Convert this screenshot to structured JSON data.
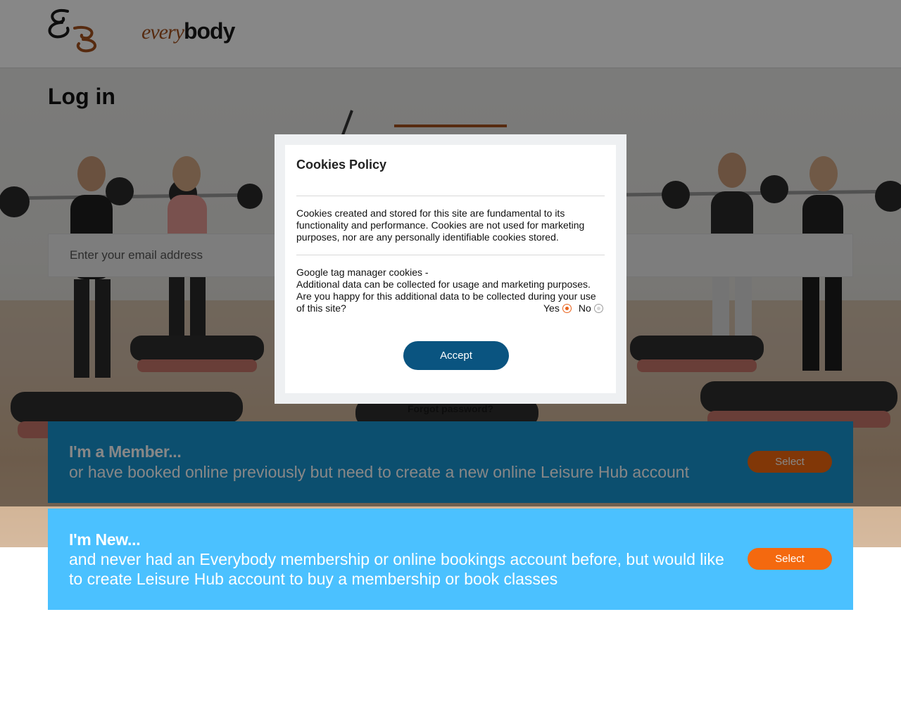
{
  "header": {
    "logo_every": "every",
    "logo_body": "body"
  },
  "main": {
    "title": "Log in",
    "email_placeholder": "Enter your email address",
    "forgot_password": "Forgot password?"
  },
  "cards": [
    {
      "title": "I'm a Member...",
      "description": "or have booked online previously but need to create a new online Leisure Hub account",
      "button_label": "Select"
    },
    {
      "title": "I'm New...",
      "description": "and never had an Everybody membership or online bookings account before, but would like to create Leisure Hub account to buy a membership or book classes",
      "button_label": "Select"
    }
  ],
  "cookie_modal": {
    "title": "Cookies Policy",
    "paragraph1": "Cookies created and stored for this site are fundamental to its functionality and performance. Cookies are not used for marketing purposes, nor are any personally identifiable cookies stored.",
    "paragraph2_line1": "Google tag manager cookies -",
    "paragraph2_line2": "Additional data can be collected for usage and marketing purposes.",
    "paragraph2_line3": "Are you happy for this additional data to be collected during your use of this site?",
    "yes_label": "Yes",
    "no_label": "No",
    "selected_option": "Yes",
    "accept_label": "Accept"
  },
  "colors": {
    "brand_orange": "#f4690f",
    "brand_brown": "#a4521f",
    "member_card": "#1795d2",
    "new_card": "#4bc1ff",
    "accept_button": "#0a5480"
  }
}
